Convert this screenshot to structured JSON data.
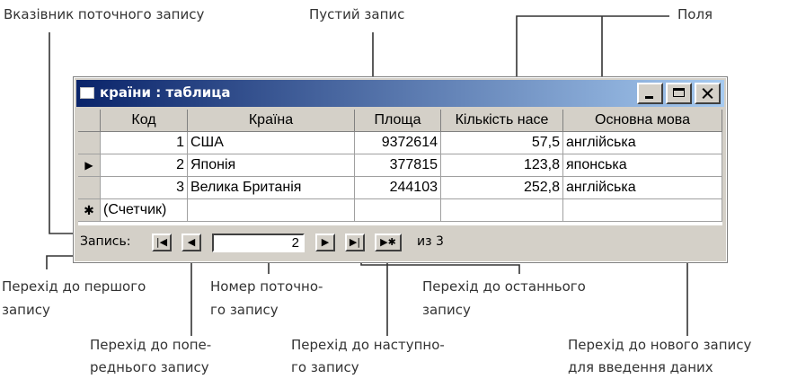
{
  "annotations": {
    "current_record_pointer": "Вказівник поточного запису",
    "empty_record": "Пустий запис",
    "fields": "Поля",
    "first_record_l1": "Перехід до першого",
    "first_record_l2": "запису",
    "current_number_l1": "Номер поточно-",
    "current_number_l2": "го запису",
    "last_record_l1": "Перехід до останнього",
    "last_record_l2": "запису",
    "prev_record_l1": "Перехід до попе-",
    "prev_record_l2": "реднього запису",
    "next_record_l1": "Перехід до наступно-",
    "next_record_l2": "го запису",
    "new_record_l1": "Перехід до нового запису",
    "new_record_l2": "для введення даних"
  },
  "window": {
    "title": "країни : таблица",
    "icon": "table-icon",
    "controls": [
      "minimize-icon",
      "maximize-icon",
      "close-icon"
    ]
  },
  "table": {
    "columns": [
      "Код",
      "Країна",
      "Площа",
      "Кількість насе",
      "Основна мова"
    ],
    "rows": [
      {
        "selector": "",
        "code": "1",
        "country": "США",
        "area": "9372614",
        "population": "57,5",
        "language": "англійська"
      },
      {
        "selector": "▶",
        "code": "2",
        "country": "Японія",
        "area": "377815",
        "population": "123,8",
        "language": "японська"
      },
      {
        "selector": "",
        "code": "3",
        "country": "Велика Британія",
        "area": "244103",
        "population": "252,8",
        "language": "англійська"
      }
    ],
    "new_row": {
      "selector": "✱",
      "code": "(Счетчик)"
    }
  },
  "navigation": {
    "label": "Запись:",
    "first": "|◀",
    "prev": "◀",
    "current": "2",
    "next": "▶",
    "last": "▶|",
    "new": "▶✱",
    "of_label": "из 3"
  }
}
